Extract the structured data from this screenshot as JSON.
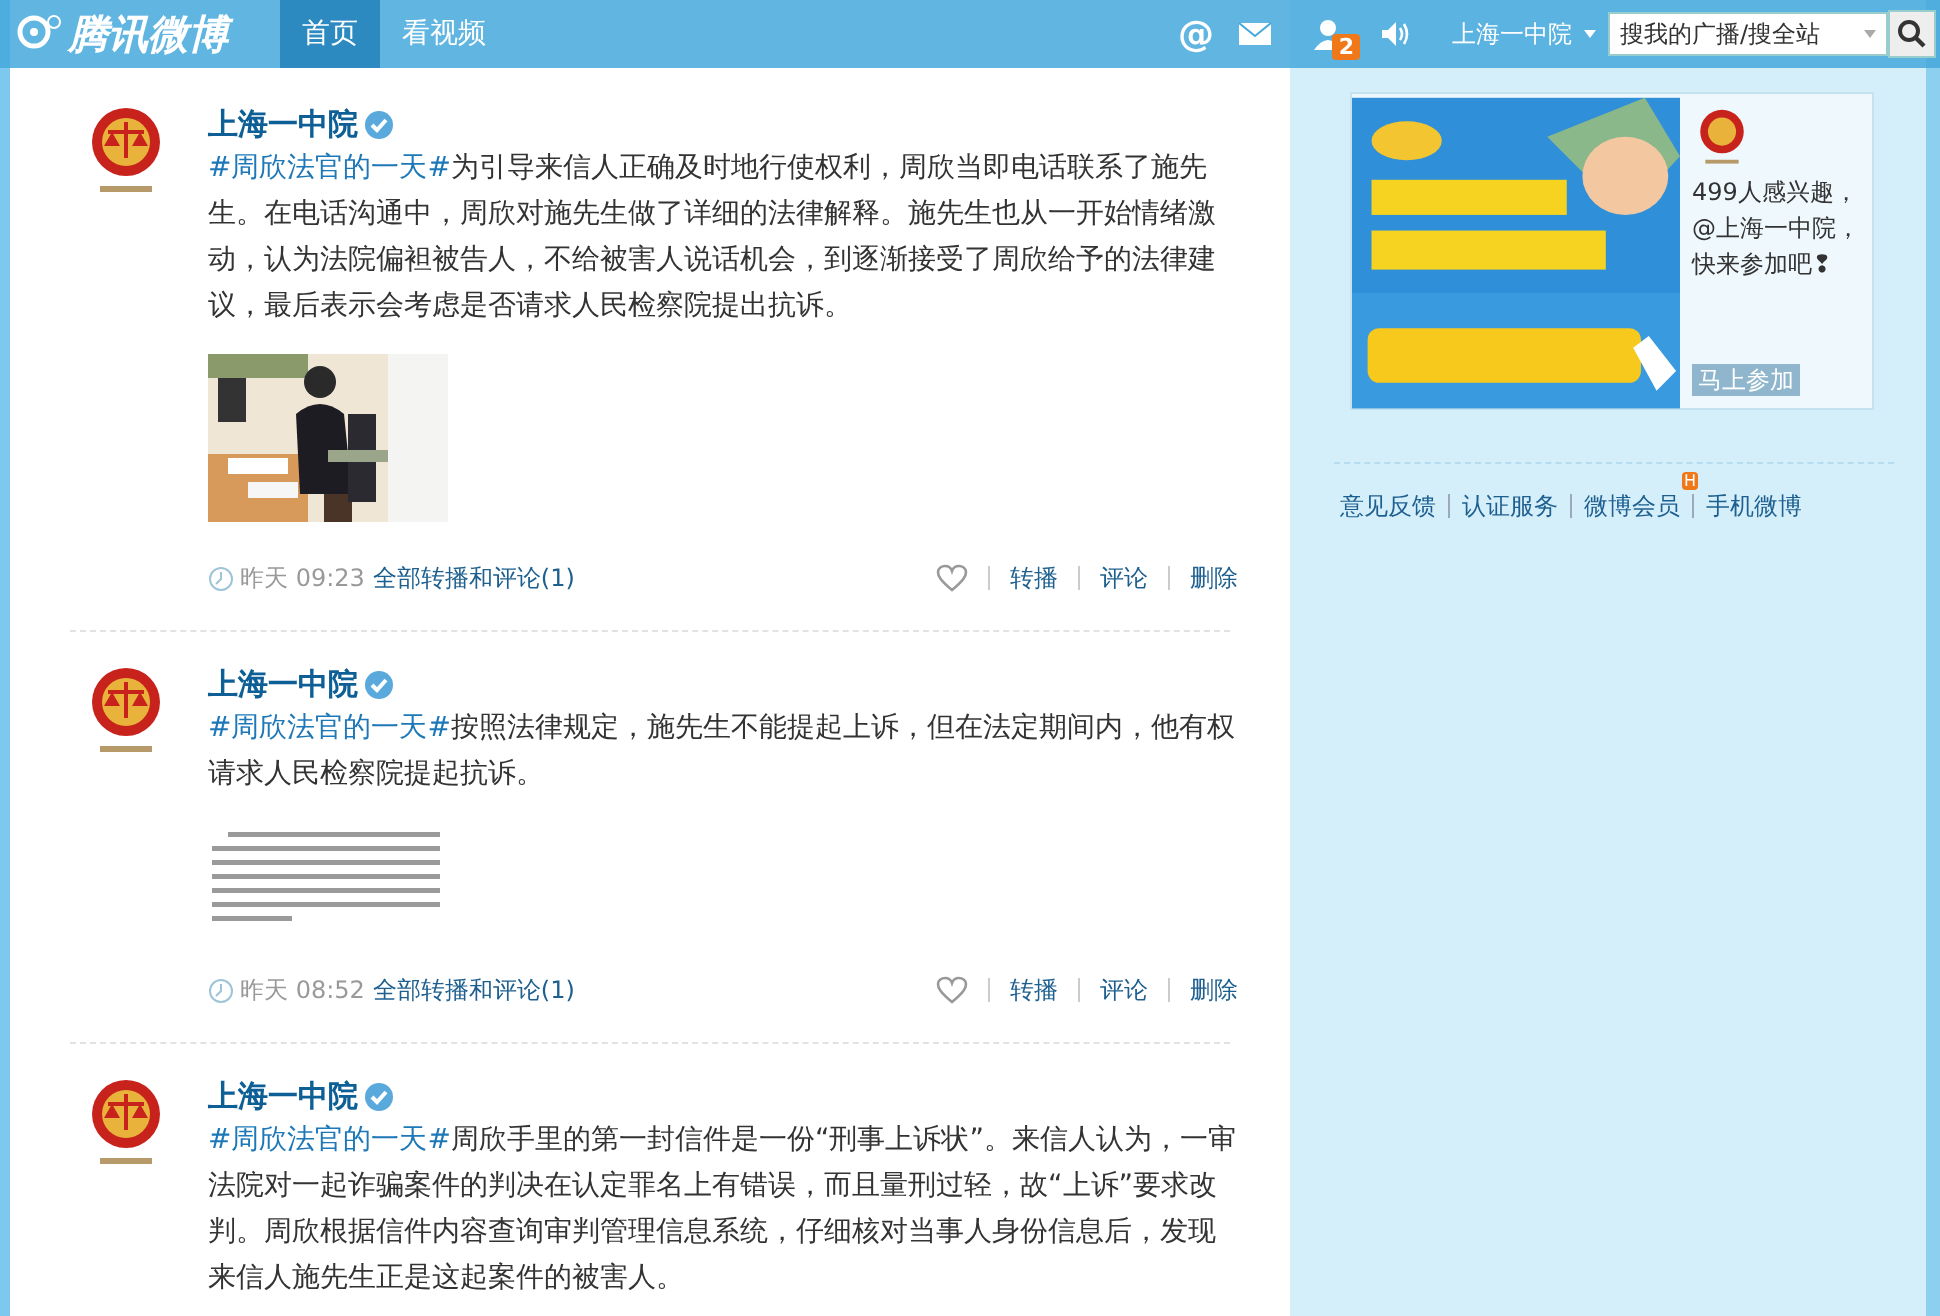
{
  "header": {
    "logo": "腾讯微博",
    "nav": [
      {
        "label": "首页",
        "selected": true
      },
      {
        "label": "看视频",
        "selected": false
      }
    ],
    "mention_icon": "@",
    "notification_badge": "2",
    "user": "上海一中院",
    "search": {
      "placeholder": "搜我的广播/搜全站"
    }
  },
  "posts": [
    {
      "author": "上海一中院",
      "verified": true,
      "topic": "#周欣法官的一天#",
      "text": "为引导来信人正确及时地行使权利，周欣当即电话联系了施先生。在电话沟通中，周欣对施先生做了详细的法律解释。施先生也从一开始情绪激动，认为法院偏袒被告人，不给被害人说话机会，到逐渐接受了周欣给予的法律建议，最后表示会考虑是否请求人民检察院提出抗诉。",
      "image": {
        "kind": "picture"
      },
      "time": "昨天 09:23",
      "thread_link": "全部转播和评论(1)",
      "actions": [
        "转播",
        "评论",
        "删除"
      ]
    },
    {
      "author": "上海一中院",
      "verified": true,
      "topic": "#周欣法官的一天#",
      "text": "按照法律规定，施先生不能提起上诉，但在法定期间内，他有权请求人民检察院提起抗诉。",
      "image": {
        "kind": "picture"
      },
      "time": "昨天 08:52",
      "thread_link": "全部转播和评论(1)",
      "actions": [
        "转播",
        "评论",
        "删除"
      ]
    },
    {
      "author": "上海一中院",
      "verified": true,
      "topic": "#周欣法官的一天#",
      "text": "周欣手里的第一封信件是一份“刑事上诉状”。来信人认为，一审法院对一起诈骗案件的判决在认定罪名上有错误，而且量刑过轻，故“上诉”要求改判。周欣根据信件内容查询审判管理信息系统，仔细核对当事人身份信息后，发现来信人施先生正是这起案件的被害人。"
    }
  ],
  "sidebar": {
    "promo": {
      "text": "499人感兴趣，@上海一中院，快来参加吧❢",
      "button": "马上参加"
    },
    "links": [
      {
        "label": "意见反馈"
      },
      {
        "label": "认证服务"
      },
      {
        "label": "微博会员",
        "badge": "H"
      },
      {
        "label": "手机微博"
      }
    ]
  }
}
